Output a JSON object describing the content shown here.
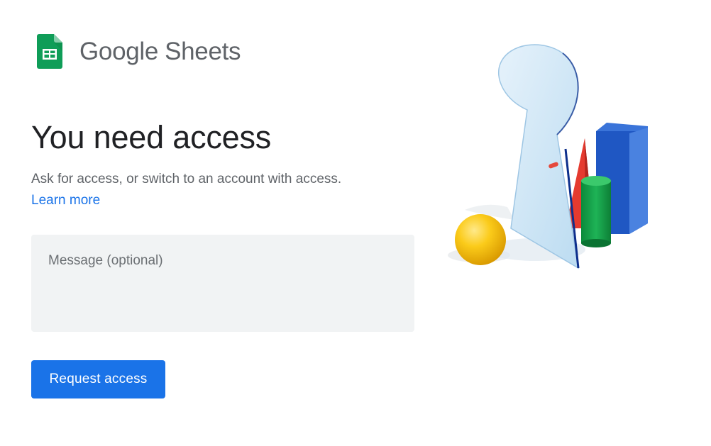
{
  "logo": {
    "brand": "Google",
    "product": "Sheets",
    "icon": "google-sheets-icon",
    "icon_color": "#0f9d58"
  },
  "main": {
    "heading": "You need access",
    "description": "Ask for access, or switch to an account with access.",
    "learn_more": "Learn more"
  },
  "form": {
    "message_placeholder": "Message (optional)",
    "message_value": "",
    "submit_label": "Request access"
  },
  "illustration": {
    "icon": "keyhole-mirror-illustration"
  },
  "colors": {
    "accent": "#1a73e8",
    "field_background": "#f1f3f4",
    "text_primary": "#202124",
    "text_secondary": "#5f6368"
  }
}
